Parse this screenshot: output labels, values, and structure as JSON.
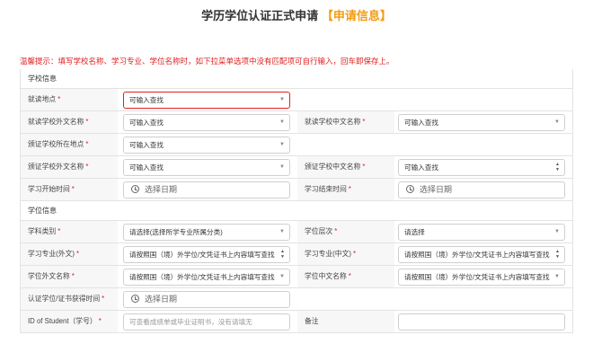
{
  "page": {
    "title_main": "学历学位认证正式申请",
    "title_hl": "【申请信息】",
    "notice": "温馨提示：填写学校名称、学习专业、学位名称时，如下拉菜单选项中没有匹配项可自行输入，回车即保存上。"
  },
  "school": {
    "section": "学校信息",
    "study_location": {
      "label": "就读地点",
      "req": "*",
      "value": "可输入查找"
    },
    "school_foreign": {
      "label": "就读学校外文名称",
      "req": "*",
      "value": "可输入查找"
    },
    "school_chinese": {
      "label": "就读学校中文名称",
      "req": "*",
      "value": "可输入查找"
    },
    "cert_location": {
      "label": "颁证学校所在地点",
      "req": "*",
      "value": "可输入查找"
    },
    "cert_foreign": {
      "label": "颁证学校外文名称",
      "req": "*",
      "value": "可输入查找"
    },
    "cert_chinese": {
      "label": "颁证学校中文名称",
      "req": "*",
      "value": "可输入查找"
    },
    "start_time": {
      "label": "学习开始时间",
      "req": "*",
      "placeholder": "选择日期"
    },
    "end_time": {
      "label": "学习结束时间",
      "req": "*",
      "placeholder": "选择日期"
    }
  },
  "degree": {
    "section": "学位信息",
    "subject": {
      "label": "学科类别",
      "req": "*",
      "value": "请选择(选择所学专业所属分类)"
    },
    "level": {
      "label": "学位层次",
      "req": "*",
      "value": "请选择"
    },
    "major_foreign": {
      "label": "学习专业(外文)",
      "req": "*",
      "value": "请按照国（境）外学位/文凭证书上内容填写查找"
    },
    "major_chinese": {
      "label": "学习专业(中文)",
      "req": "*",
      "value": "请按照国（境）外学位/文凭证书上内容填写查找"
    },
    "degree_foreign": {
      "label": "学位外文名称",
      "req": "*",
      "value": "请按照国（境）外学位/文凭证书上内容填写查找"
    },
    "degree_chinese": {
      "label": "学位中文名称",
      "req": "*",
      "value": "请按照国（境）外学位/文凭证书上内容填写查找"
    },
    "award_time": {
      "label": "认证学位/证书获得时间",
      "req": "*",
      "placeholder": "选择日期"
    },
    "student_id": {
      "label": "ID of Student（学号）",
      "req": "*",
      "placeholder": "可查看成绩单或毕业证明书，没有请填无"
    },
    "remark": {
      "label": "备注",
      "value": ""
    }
  },
  "icons": {
    "dropdown": "chevron-down-icon",
    "updown": "updown-icon",
    "clock": "clock-icon"
  }
}
